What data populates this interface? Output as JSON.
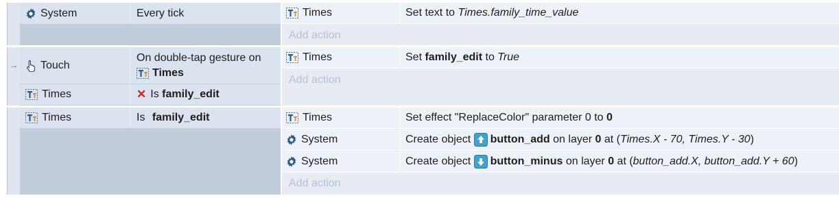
{
  "events": [
    {
      "conditions": [
        {
          "object": "System",
          "text": "Every tick"
        }
      ],
      "actions": [
        {
          "object": "Times",
          "text_prefix": "Set text to ",
          "text_value": "Times.family_time_value"
        }
      ],
      "add_action": "Add action"
    },
    {
      "trigger_arrow": "→",
      "conditions": [
        {
          "object": "Touch",
          "line1": "On double-tap gesture on",
          "line2_object": "Times"
        },
        {
          "object": "Times",
          "invert_mark": "✕",
          "text_prefix": "Is ",
          "text_bold": "family_edit"
        }
      ],
      "actions": [
        {
          "object": "Times",
          "text_prefix": "Set ",
          "text_bold": "family_edit",
          "text_mid": " to ",
          "text_italic": "True"
        }
      ],
      "add_action": "Add action"
    },
    {
      "conditions": [
        {
          "object": "Times",
          "text_prefix": "Is ",
          "text_bold": "family_edit"
        }
      ],
      "actions": [
        {
          "object": "Times",
          "text_prefix": "Set effect \"ReplaceColor\" parameter 0 to ",
          "text_bold": "0"
        },
        {
          "object": "System",
          "text_prefix": "Create object ",
          "sprite_bold": "button_add",
          "layer_prefix": " on layer ",
          "layer": "0",
          "at_prefix": " at (",
          "at_value": "Times.X - 70, Times.Y - 30",
          "at_suffix": ")"
        },
        {
          "object": "System",
          "text_prefix": "Create object ",
          "sprite_bold": "button_minus",
          "layer_prefix": " on layer ",
          "layer": "0",
          "at_prefix": " at (",
          "at_value": "button_add.X, button_add.Y + 60",
          "at_suffix": ")"
        }
      ],
      "add_action": "Add action"
    }
  ]
}
